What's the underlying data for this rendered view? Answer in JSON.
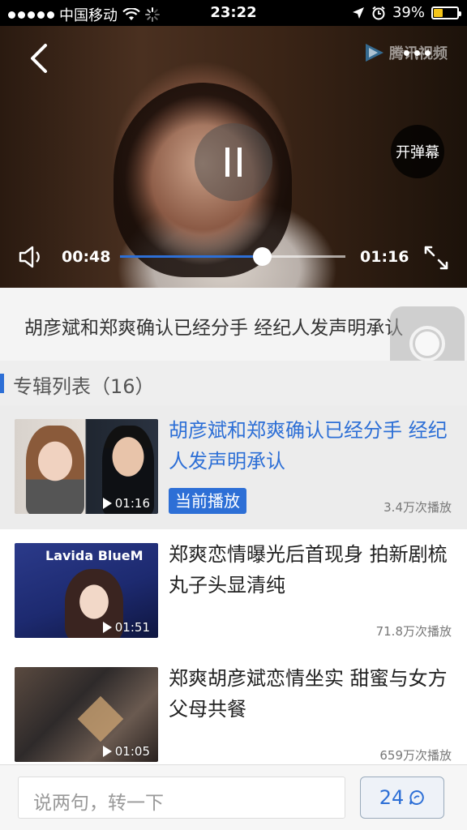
{
  "status_bar": {
    "carrier": "中国移动",
    "time": "23:22",
    "battery": "39%",
    "battery_level": 0.39
  },
  "player": {
    "logo_text": "腾讯视频",
    "danmu_button": "开弹幕",
    "current_time": "00:48",
    "total_time": "01:16",
    "progress": 0.63
  },
  "video_title": "胡彦斌和郑爽确认已经分手 经纪人发声明承认",
  "album": {
    "label": "专辑列表（16）",
    "items": [
      {
        "title": "胡彦斌和郑爽确认已经分手 经纪人发声明承认",
        "duration": "01:16",
        "plays": "3.4万次播放",
        "badge": "当前播放",
        "current": true
      },
      {
        "title": "郑爽恋情曝光后首现身 拍新剧梳丸子头显清纯",
        "duration": "01:51",
        "plays": "71.8万次播放",
        "thumb_text": "Lavida BlueM",
        "current": false
      },
      {
        "title": "郑爽胡彦斌恋情坐实  甜蜜与女方父母共餐",
        "duration": "01:05",
        "plays": "659万次播放",
        "current": false
      }
    ]
  },
  "bottom_bar": {
    "comment_placeholder": "说两句，转一下",
    "comment_count": "24"
  },
  "colors": {
    "accent": "#2d6fd6",
    "battery": "#f5c518"
  }
}
